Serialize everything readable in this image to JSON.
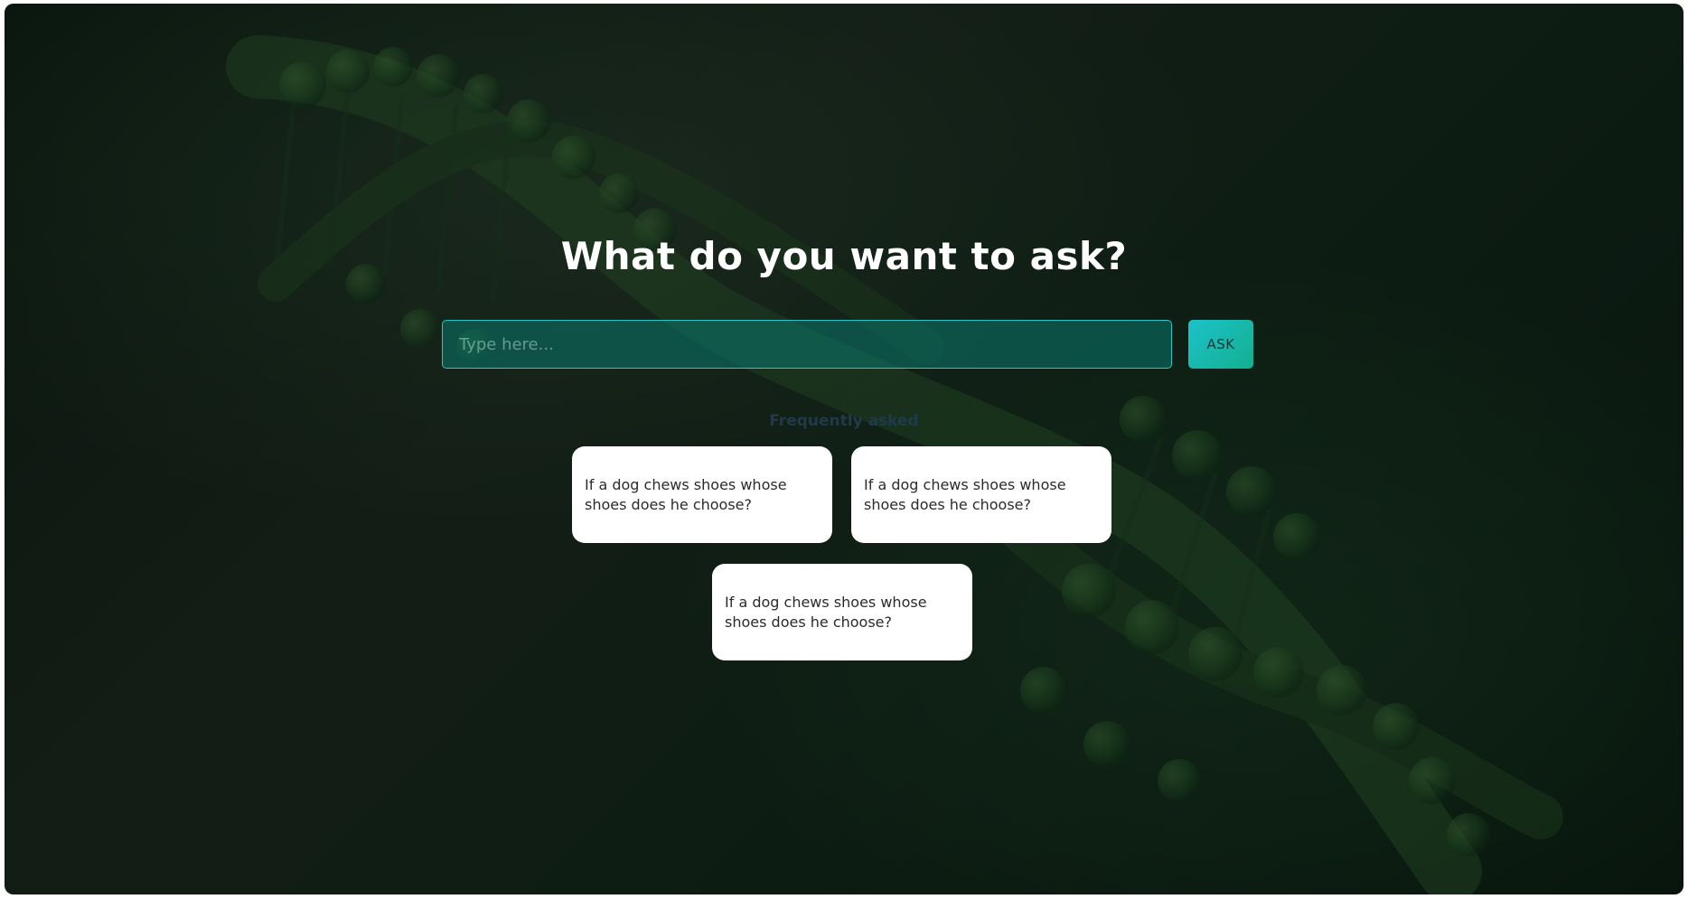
{
  "hero": {
    "title": "What do you want to ask?"
  },
  "search": {
    "placeholder": "Type here...",
    "value": "",
    "button_label": "ASK"
  },
  "faq": {
    "heading": "Frequently asked",
    "items": [
      {
        "text": "If a dog chews shoes whose shoes does he choose?"
      },
      {
        "text": "If a dog chews shoes whose shoes does he choose?"
      },
      {
        "text": "If a dog chews shoes whose shoes does he choose?"
      }
    ]
  },
  "theme": {
    "accent": "#1cc2c9",
    "accent_secondary": "#13b08f",
    "background": "#12251a",
    "card_background": "#ffffff"
  },
  "background_image": {
    "icon": "dna-helix-image"
  }
}
